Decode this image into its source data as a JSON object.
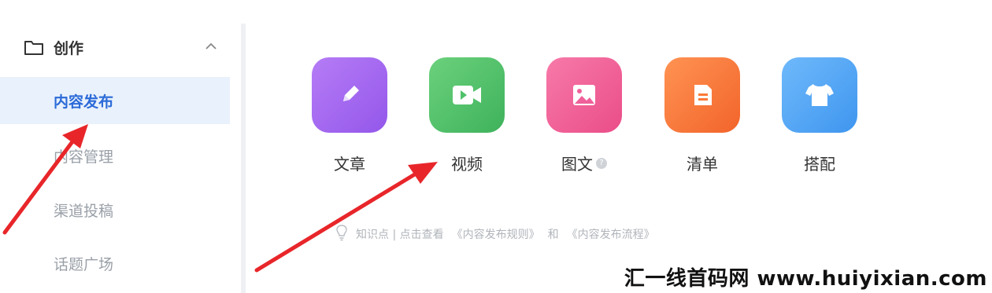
{
  "sidebar": {
    "section_label": "创作",
    "items": [
      {
        "label": "内容发布",
        "active": true
      },
      {
        "label": "内容管理",
        "active": false
      },
      {
        "label": "渠道投稿",
        "active": false
      },
      {
        "label": "话题广场",
        "active": false
      }
    ]
  },
  "tools": [
    {
      "label": "文章",
      "icon": "pen-icon",
      "color": "#a56df0"
    },
    {
      "label": "视频",
      "icon": "video-icon",
      "color": "#4fc26a"
    },
    {
      "label": "图文",
      "icon": "image-icon",
      "color": "#f0609a"
    },
    {
      "label": "清单",
      "icon": "list-icon",
      "color": "#fb7a3a"
    },
    {
      "label": "搭配",
      "icon": "shirt-icon",
      "color": "#4fa6f5"
    }
  ],
  "tip": {
    "prefix": "知识点 | 点击查看",
    "link1": "《内容发布规则》",
    "joiner": "和",
    "link2": "《内容发布流程》"
  },
  "watermark": "汇一线首码网 www.huiyixian.com",
  "annotation_color": "#e8262a"
}
